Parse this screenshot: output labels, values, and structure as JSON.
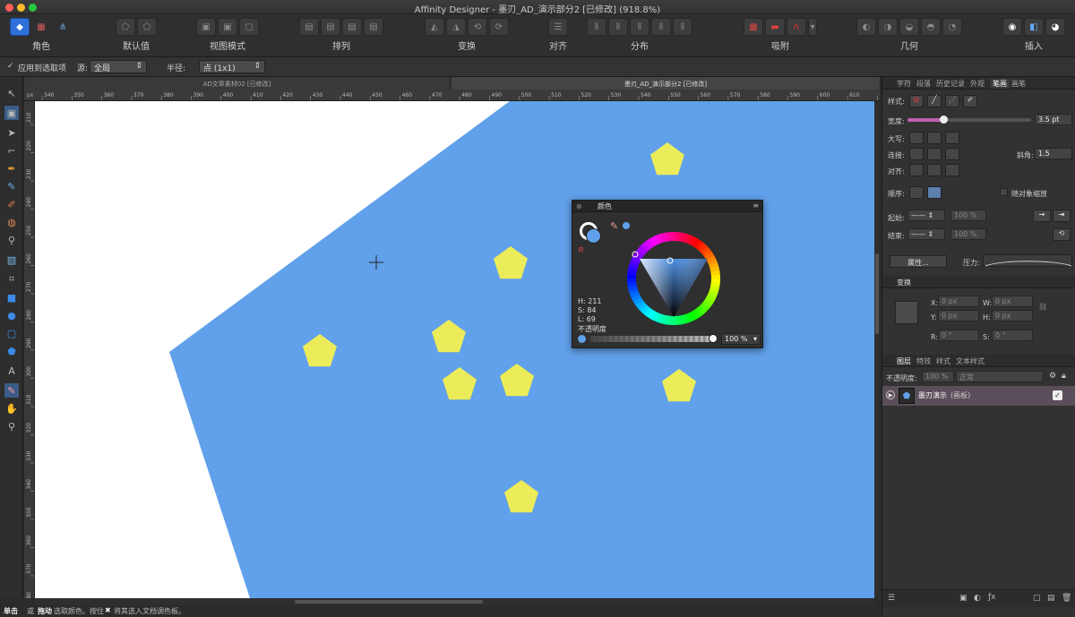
{
  "window": {
    "title": "Affinity Designer - 墨刃_AD_演示部分2 [已修改] (918.8%)"
  },
  "colors": {
    "canvas_blue": "#61a0ea",
    "pentagon_yellow": "#ecec5a",
    "accent": "#2f6fd8"
  },
  "toolbar": {
    "groups": [
      {
        "label": "角色"
      },
      {
        "label": "默认值"
      },
      {
        "label": "视图模式"
      },
      {
        "label": "排列"
      },
      {
        "label": "变换"
      },
      {
        "label": "对齐"
      },
      {
        "label": "分布"
      },
      {
        "label": "吸附"
      },
      {
        "label": "几何"
      },
      {
        "label": "插入"
      }
    ]
  },
  "context": {
    "apply_label": "应用到选取项",
    "source_label": "源:",
    "source_value": "全局",
    "radius_label": "半径:",
    "radius_value": "点 (1x1)"
  },
  "doc_tabs": [
    "AD文章素材02 [已修改]",
    "墨刃_AD_演示部分2 [已修改]"
  ],
  "ruler": {
    "unit": "px",
    "h_ticks": [
      "340",
      "350",
      "360",
      "370",
      "380",
      "390",
      "400",
      "410",
      "420",
      "430",
      "440",
      "450",
      "460",
      "470",
      "480",
      "490",
      "500",
      "510",
      "520",
      "530",
      "540",
      "550",
      "560",
      "570",
      "580",
      "590",
      "600",
      "610",
      "620"
    ],
    "v_ticks": [
      "210",
      "220",
      "230",
      "240",
      "250",
      "260",
      "270",
      "280",
      "290",
      "300",
      "310",
      "320",
      "330",
      "340",
      "350",
      "360",
      "370",
      "380"
    ]
  },
  "color_panel": {
    "title": "颜色",
    "h": "H: 211",
    "s": "S: 84",
    "l": "L: 69",
    "opacity_label": "不透明度",
    "opacity_value": "100 %"
  },
  "stroke_panel": {
    "tabs": [
      "字符",
      "段落",
      "历史记录",
      "外观",
      "笔画",
      "画笔"
    ],
    "style_label": "样式:",
    "width_label": "宽度:",
    "width_value": "3.5 pt",
    "cap_label": "大写:",
    "join_label": "连接:",
    "miter_label": "斜角:",
    "miter_value": "1.5",
    "align_label": "对齐:",
    "order_label": "顺序:",
    "scale_label": "随对象缩放",
    "start_label": "起始:",
    "end_label": "结束:",
    "start_pct": "100 %",
    "end_pct": "100 %",
    "props_label": "属性...",
    "pressure_label": "压力:"
  },
  "transform_panel": {
    "title": "变换",
    "x_label": "X:",
    "x_value": "0 px",
    "w_label": "W:",
    "w_value": "0 px",
    "y_label": "Y:",
    "y_value": "0 px",
    "h_label": "H:",
    "h_value": "0 px",
    "r_label": "R:",
    "r_value": "0 °",
    "s_label": "S:",
    "s_value": "0 °"
  },
  "layers_panel": {
    "tabs": [
      "图层",
      "特效",
      "样式",
      "文本样式"
    ],
    "opacity_label": "不透明度:",
    "opacity_value": "100 %",
    "blend_value": "正常",
    "layer_name": "墨刃演示",
    "layer_type": "(画板)"
  },
  "status": {
    "click": "单击",
    "or": "或",
    "drag": "拖动",
    "text": "选取颜色。按住",
    "key": "✖",
    "text2": "将其选入文档调色板。"
  }
}
